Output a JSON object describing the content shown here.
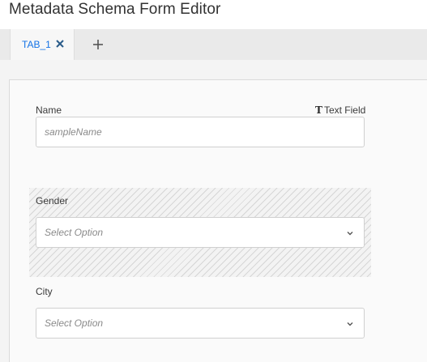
{
  "app": {
    "title": "Metadata Schema Form Editor"
  },
  "tabs": [
    {
      "label": "TAB_1",
      "active": true,
      "close_icon": "close-icon"
    }
  ],
  "add_tab": {
    "icon": "plus-icon"
  },
  "form": {
    "fields": [
      {
        "label": "Name",
        "type_label": "Text Field",
        "type_icon": "text-field-icon",
        "placeholder": "sampleName",
        "kind": "text"
      },
      {
        "label": "Gender",
        "placeholder": "Select Option",
        "kind": "dropdown",
        "dragging": true,
        "icon": "chevron-down-icon"
      },
      {
        "label": "City",
        "placeholder": "Select Option",
        "kind": "dropdown",
        "icon": "chevron-down-icon"
      }
    ]
  },
  "colors": {
    "accent": "#1473e6",
    "border": "#d0d0d0",
    "hatch": "#d6d6d6"
  }
}
